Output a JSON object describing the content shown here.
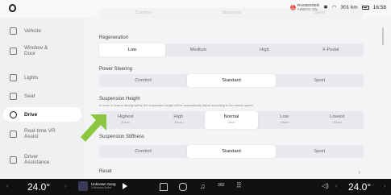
{
  "status": {
    "airbag_line1": "PASSENGER",
    "airbag_line2": "AIRBAG ON",
    "range": "301 km",
    "time": "16:58"
  },
  "sidebar": {
    "items": [
      {
        "label": "Vehicle"
      },
      {
        "label": "Window &\nDoor"
      },
      {
        "label": "Lights"
      },
      {
        "label": "Seat"
      },
      {
        "label": "Drive"
      },
      {
        "label": "Real-time VR\nAssist"
      },
      {
        "label": "Driver\nAssistance"
      }
    ]
  },
  "top_partial": [
    "Comfort",
    "Standard",
    "Sport"
  ],
  "regeneration": {
    "title": "Regeneration",
    "options": [
      "Low",
      "Medium",
      "High",
      "X-Pedal"
    ]
  },
  "power_steering": {
    "title": "Power Steering",
    "options": [
      "Comfort",
      "Standard",
      "Sport"
    ]
  },
  "suspension_height": {
    "title": "Suspension Height",
    "description": "In order to ensure driving safety, the suspension height will be automatically adjust according to the vehicle speed",
    "options": [
      {
        "label": "Highest",
        "sub": "50mm"
      },
      {
        "label": "High",
        "sub": "30mm"
      },
      {
        "label": "Normal",
        "sub": "0mm"
      },
      {
        "label": "Low",
        "sub": "-15mm"
      },
      {
        "label": "Lowest",
        "sub": "-30mm"
      }
    ]
  },
  "suspension_stiffness": {
    "title": "Suspension Stiffness",
    "options": [
      "Comfort",
      "Standard",
      "Sport"
    ]
  },
  "reset": "Reset",
  "bottom": {
    "left_temp": "24.0°",
    "right_temp": "24.0°",
    "song_title": "Unknown Song",
    "song_artist": "Unknown Artist",
    "icon_360": "360"
  }
}
